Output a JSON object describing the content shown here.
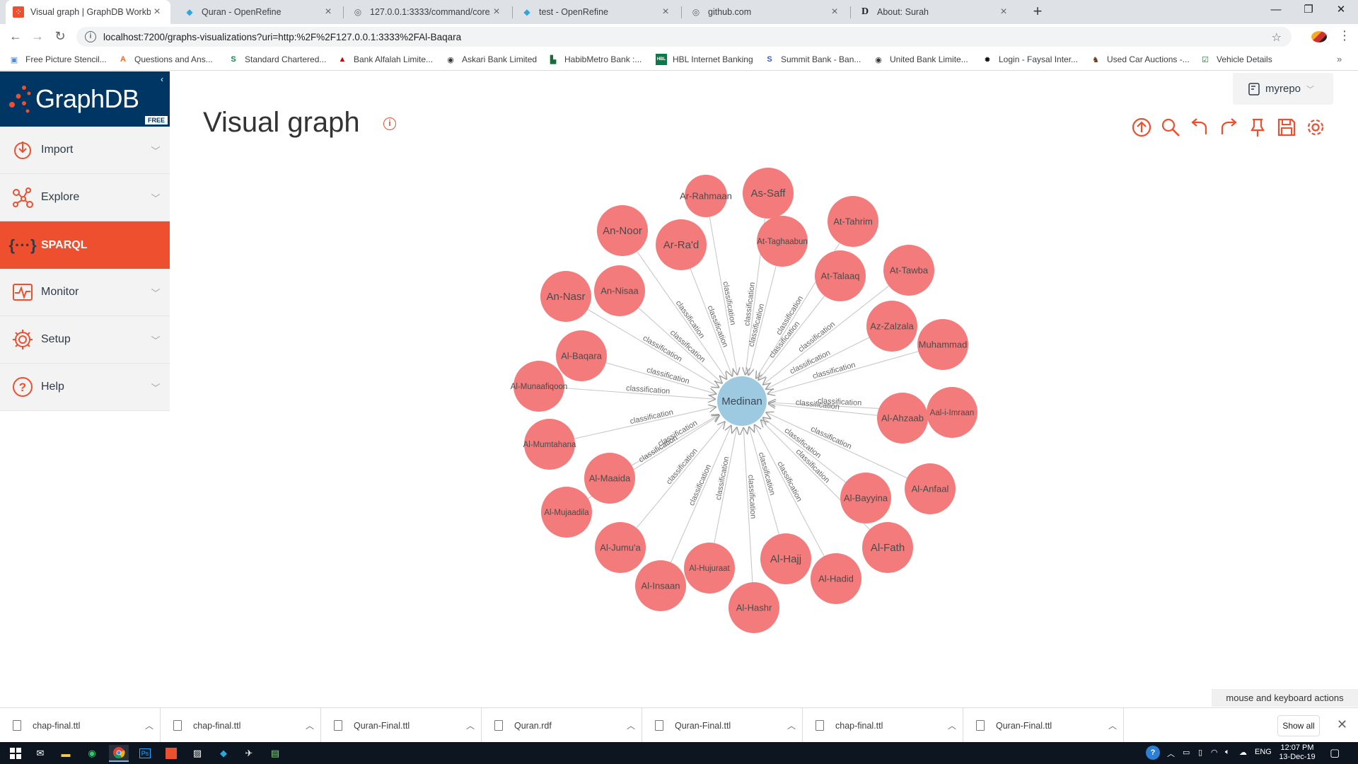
{
  "browser": {
    "tabs": [
      {
        "title": "Visual graph | GraphDB Workbench",
        "favicon": "graphdb",
        "active": true
      },
      {
        "title": "Quran - OpenRefine",
        "favicon": "openrefine",
        "active": false
      },
      {
        "title": "127.0.0.1:3333/command/core/e...",
        "favicon": "globe",
        "active": false
      },
      {
        "title": "test - OpenRefine",
        "favicon": "openrefine",
        "active": false
      },
      {
        "title": "github.com",
        "favicon": "globe",
        "active": false
      },
      {
        "title": "About: Surah",
        "favicon": "dbpedia",
        "active": false
      }
    ],
    "new_tab_label": "+",
    "window_controls": [
      "—",
      "❐",
      "✕"
    ],
    "url": "localhost:7200/graphs-visualizations?uri=http:%2F%2F127.0.0.1:3333%2FAl-Baqara",
    "bookmarks": [
      "Free Picture Stencil...",
      "Questions and Ans...",
      "Standard Chartered...",
      "Bank Alfalah Limite...",
      "Askari Bank Limited",
      "HabibMetro Bank :...",
      "HBL Internet Banking",
      "Summit Bank - Ban...",
      "United Bank Limite...",
      "Login - Faysal Inter...",
      "Used Car Auctions -...",
      "Vehicle Details"
    ],
    "bookmark_more": "»"
  },
  "app": {
    "logo_text": "GraphDB",
    "edition_badge": "FREE",
    "nav": [
      {
        "label": "Import",
        "icon": "import-icon",
        "active": false
      },
      {
        "label": "Explore",
        "icon": "explore-icon",
        "active": false
      },
      {
        "label": "SPARQL",
        "icon": "sparql-icon",
        "active": true
      },
      {
        "label": "Monitor",
        "icon": "monitor-icon",
        "active": false
      },
      {
        "label": "Setup",
        "icon": "setup-icon",
        "active": false
      },
      {
        "label": "Help",
        "icon": "help-icon",
        "active": false
      }
    ],
    "page_title": "Visual graph",
    "repository": "myrepo",
    "toolbar_icons": [
      "upload-icon",
      "search-icon",
      "undo-icon",
      "redo-icon",
      "pin-icon",
      "save-icon",
      "settings-icon"
    ],
    "accent_color": "#ed4f2f",
    "keyboard_actions_label": "mouse and keyboard actions"
  },
  "graph": {
    "center": {
      "label": "Medinan",
      "color": "#9ecae1"
    },
    "edge_label": "classification",
    "node_color": "#f47b7b",
    "nodes": [
      "Ar-Rahmaan",
      "As-Saff",
      "At-Tahrim",
      "An-Noor",
      "Ar-Ra'd",
      "At-Taghaabun",
      "At-Talaaq",
      "At-Tawba",
      "An-Nasr",
      "An-Nisaa",
      "Az-Zalzala",
      "Muhammad",
      "Al-Baqara",
      "Al-Munaafiqoon",
      "Aal-i-Imraan",
      "Al-Ahzaab",
      "Al-Mumtahana",
      "Al-Maaida",
      "Al-Anfaal",
      "Al-Bayyina",
      "Al-Mujaadila",
      "Al-Jumu'a",
      "Al-Fath",
      "Al-Hajj",
      "Al-Hujuraat",
      "Al-Insaan",
      "Al-Hadid",
      "Al-Hashr"
    ]
  },
  "downloads": {
    "files": [
      "chap-final.ttl",
      "chap-final.ttl",
      "Quran-Final.ttl",
      "Quran.rdf",
      "Quran-Final.ttl",
      "chap-final.ttl",
      "Quran-Final.ttl"
    ],
    "show_all": "Show all"
  },
  "taskbar": {
    "language": "ENG",
    "time": "12:07 PM",
    "date": "13-Dec-19"
  }
}
